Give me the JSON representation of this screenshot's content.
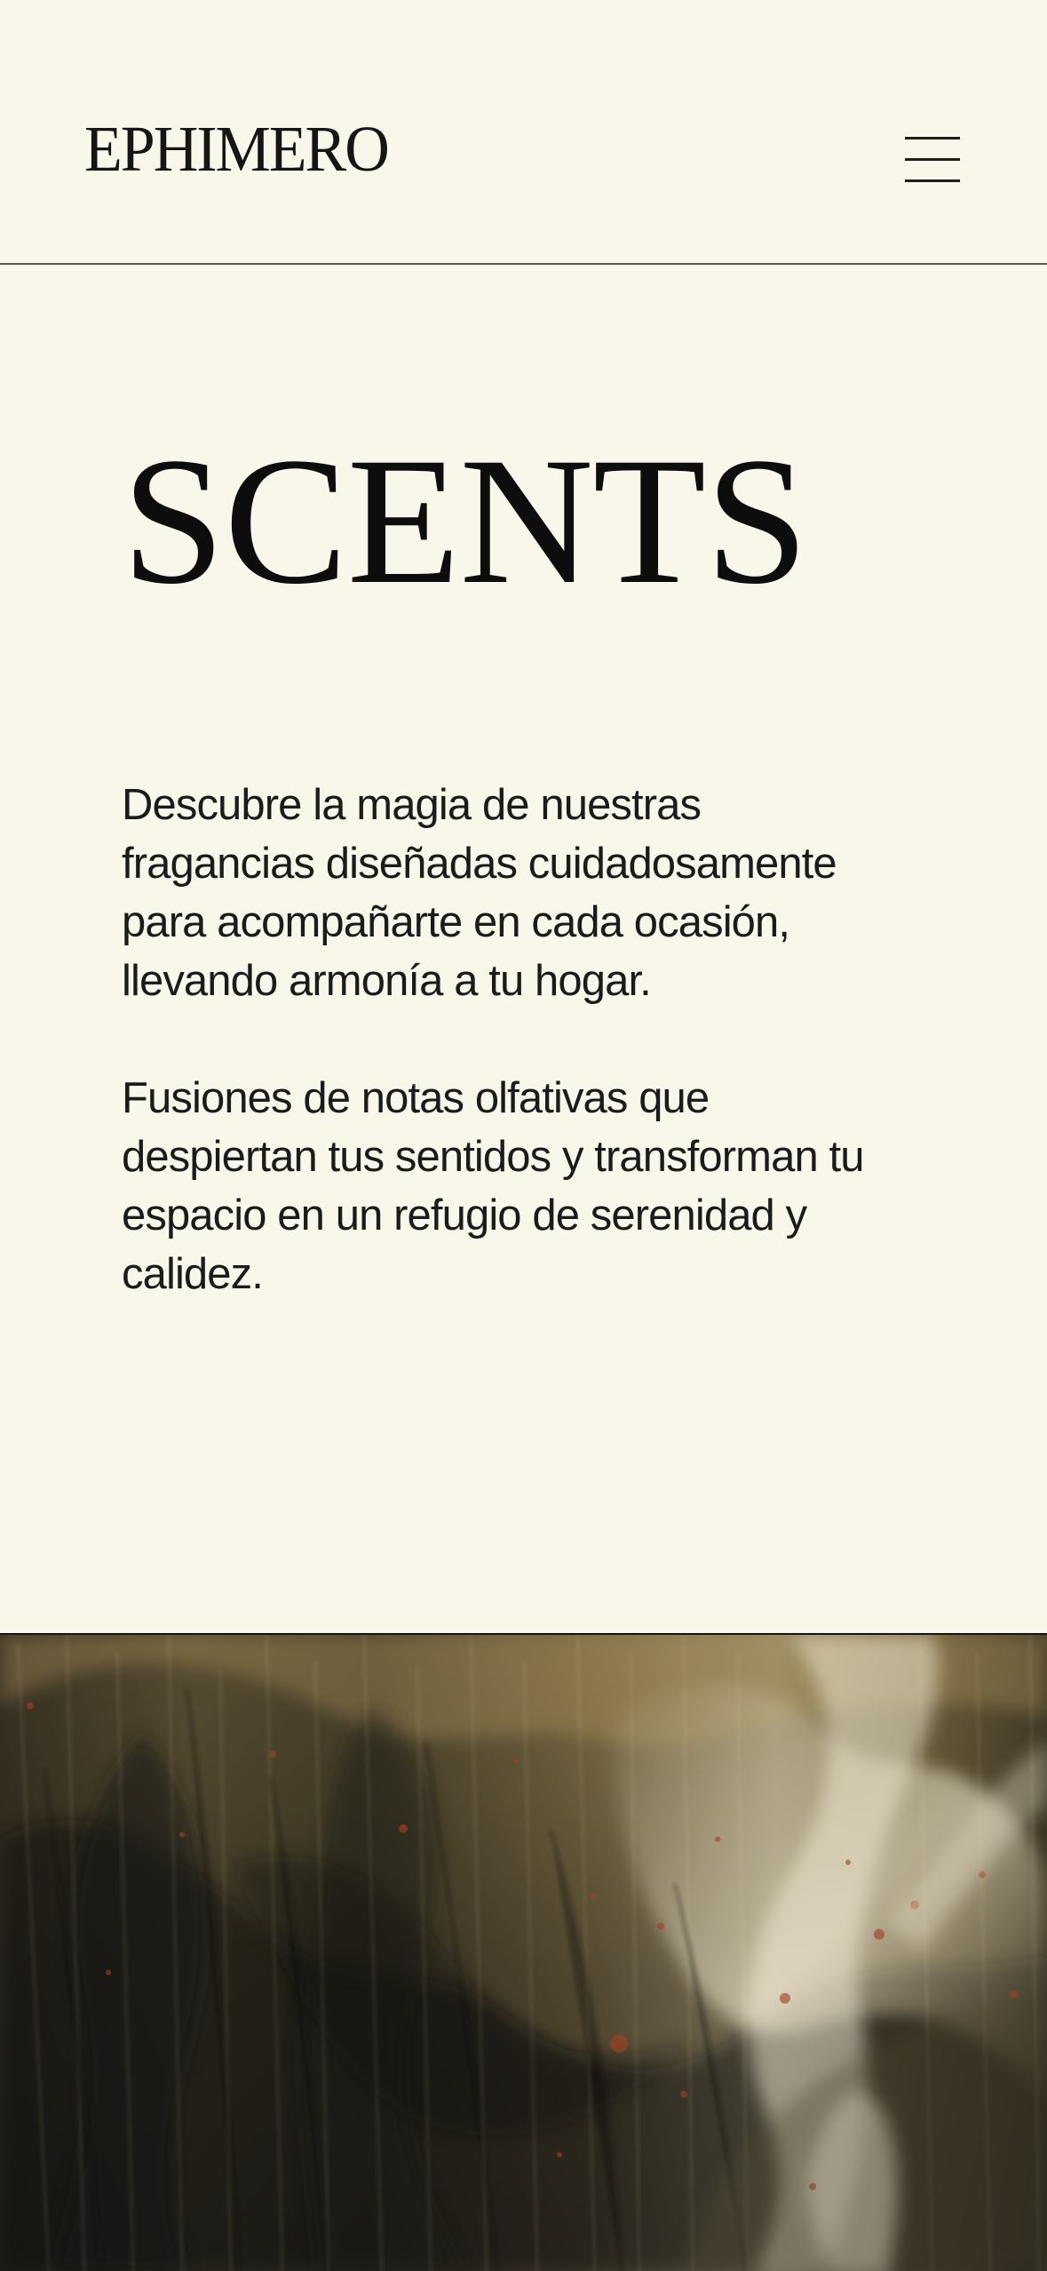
{
  "header": {
    "logo": "EPHIMERO",
    "menu_icon": "hamburger-menu-icon"
  },
  "main": {
    "title": "SCENTS",
    "paragraphs": [
      "Descubre la magia de nuestras\nfragancias diseñadas cuidadosamente\npara acompañarte en cada ocasión,\nllevando armonía a tu hogar.",
      "Fusiones de notas olfativas que\ndespiertan tus sentidos y transforman tu\nespacio en un refugio de serenidad y\ncalidez."
    ]
  },
  "colors": {
    "background": "#f8f7ea",
    "text": "#141414",
    "divider": "#5a5a54"
  }
}
